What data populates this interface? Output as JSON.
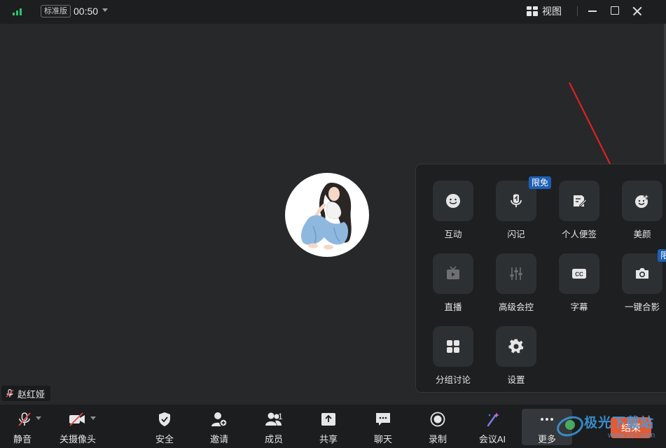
{
  "titlebar": {
    "edition_badge": "标准版",
    "timer": "00:50",
    "view_label": "视图"
  },
  "stage": {
    "participant_name": "赵红娅"
  },
  "more_panel": {
    "tiles": [
      {
        "label": "互动",
        "icon": "smile-icon"
      },
      {
        "label": "闪记",
        "icon": "mic-note-icon",
        "badge": "限免"
      },
      {
        "label": "个人便签",
        "icon": "note-edit-icon"
      },
      {
        "label": "美颜",
        "icon": "beauty-icon"
      },
      {
        "label": "直播",
        "icon": "tv-icon",
        "disabled": true
      },
      {
        "label": "高级会控",
        "icon": "sliders-icon",
        "disabled": true
      },
      {
        "label": "字幕",
        "icon": "cc-icon"
      },
      {
        "label": "一键合影",
        "icon": "camera-icon",
        "badge": "限免"
      },
      {
        "label": "分组讨论",
        "icon": "grid-four-icon"
      },
      {
        "label": "设置",
        "icon": "gear-icon"
      }
    ]
  },
  "toolbar": {
    "mute": "静音",
    "camera_off": "关摄像头",
    "security": "安全",
    "invite": "邀请",
    "members": "成员",
    "members_count": "1",
    "share": "共享",
    "chat": "聊天",
    "record": "录制",
    "meeting_ai": "会议AI",
    "more": "更多",
    "end": "结束"
  },
  "watermark": {
    "text": "极光下载站",
    "url": "www.xz7.com"
  },
  "colors": {
    "accent_red": "#e02020",
    "end_button": "#e25b35",
    "promo_badge": "#1e5fb5",
    "signal_green": "#2ec46b"
  }
}
